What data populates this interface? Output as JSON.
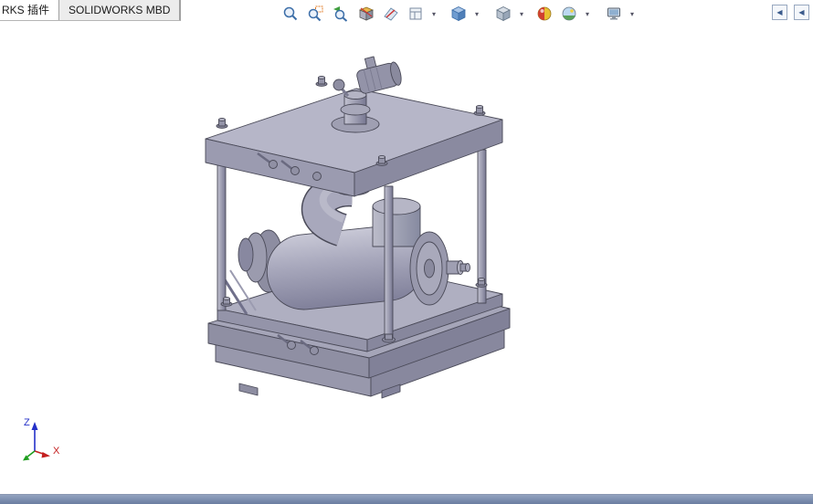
{
  "app": {
    "background": "#ffffff",
    "colors": {
      "model_body": "#a6a6ba",
      "model_edge": "#4a4a58",
      "statusbar_top": "#93a3c0",
      "statusbar_bottom": "#6a7da0"
    }
  },
  "tabs": {
    "items": [
      {
        "label": "RKS 插件"
      },
      {
        "label": "SOLIDWORKS MBD"
      }
    ]
  },
  "toolbar": {
    "dropdown_glyph": "▾",
    "icons": [
      {
        "name": "zoom-to-fit",
        "dropdown": false
      },
      {
        "name": "zoom-to-area",
        "dropdown": false
      },
      {
        "name": "previous-view",
        "dropdown": false
      },
      {
        "name": "section-view",
        "dropdown": false
      },
      {
        "name": "dynamic-annotation-views",
        "dropdown": false
      },
      {
        "name": "view-orientation",
        "dropdown": true
      },
      {
        "name": "display-style",
        "dropdown": true
      },
      {
        "name": "hide-show-items",
        "dropdown": true
      },
      {
        "name": "edit-appearance",
        "dropdown": false
      },
      {
        "name": "apply-scene",
        "dropdown": true
      },
      {
        "name": "view-settings",
        "dropdown": true
      }
    ]
  },
  "corner": {
    "collapse_glyph": "◀"
  },
  "triad": {
    "z_label": "Z",
    "x_label": "X",
    "x_color": "#c42020",
    "y_color": "#1f9e1f",
    "z_color": "#2430c8"
  }
}
